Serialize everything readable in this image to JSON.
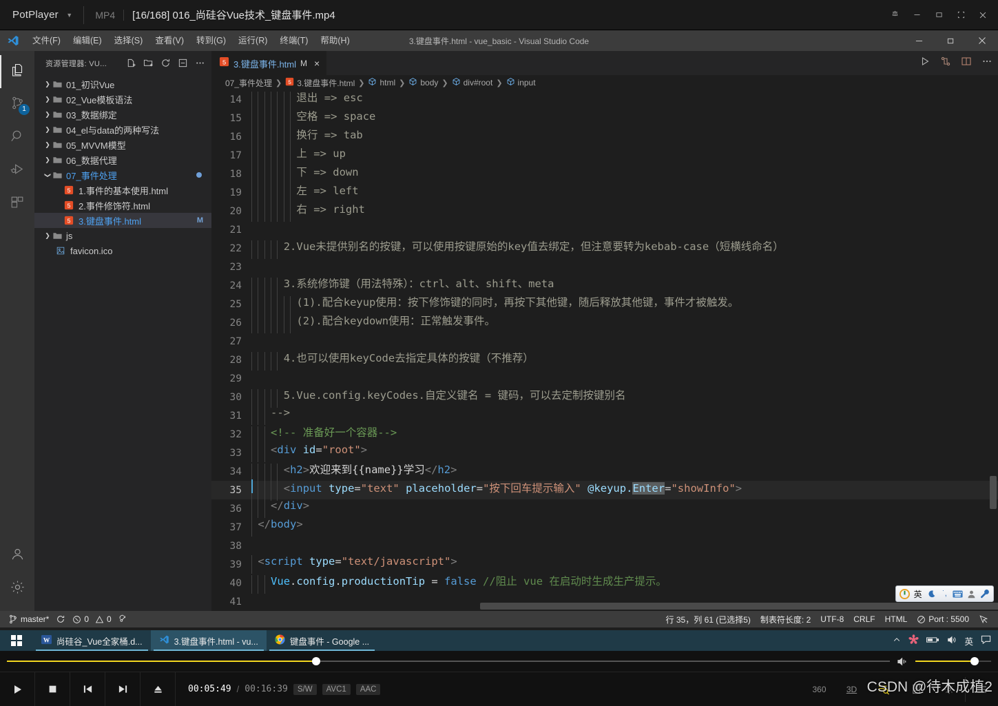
{
  "potplayer": {
    "app_name": "PotPlayer",
    "format": "MP4",
    "file_title": "[16/168] 016_尚硅谷Vue技术_键盘事件.mp4",
    "window_buttons": [
      "pin-icon",
      "minimize-icon",
      "maximize-icon",
      "fullscreen-icon",
      "close-icon"
    ],
    "controls": {
      "time_current": "00:05:49",
      "time_separator": "/",
      "time_total": "00:16:39",
      "chips": [
        "S/W",
        "AVC1",
        "AAC"
      ],
      "seek_percent": 35,
      "volume_percent": 78,
      "right_buttons": [
        "360",
        "3D",
        "playlist-search-icon",
        "playlist-icon",
        "settings-icon"
      ],
      "transport": [
        "play-icon",
        "stop-icon",
        "previous-icon",
        "next-icon",
        "eject-icon"
      ]
    },
    "watermark": "CSDN @待木成植2"
  },
  "vscode": {
    "title": "3.键盘事件.html - vue_basic - Visual Studio Code",
    "menu": [
      "文件(F)",
      "编辑(E)",
      "选择(S)",
      "查看(V)",
      "转到(G)",
      "运行(R)",
      "终端(T)",
      "帮助(H)"
    ],
    "window_buttons": [
      "minimize-icon",
      "restore-icon",
      "close-icon"
    ],
    "activitybar": [
      {
        "name": "explorer",
        "icon": "files-icon",
        "active": true,
        "badge": null
      },
      {
        "name": "source-control",
        "icon": "source-control-icon",
        "active": false,
        "badge": "1"
      },
      {
        "name": "search",
        "icon": "search-icon",
        "active": false,
        "badge": null
      },
      {
        "name": "run-and-debug",
        "icon": "run-debug-icon",
        "active": false,
        "badge": null
      },
      {
        "name": "extensions",
        "icon": "extensions-icon",
        "active": false,
        "badge": null
      },
      {
        "name": "accounts",
        "icon": "account-icon",
        "active": false,
        "badge": null
      },
      {
        "name": "settings",
        "icon": "gear-icon",
        "active": false,
        "badge": null
      }
    ],
    "explorer": {
      "header": "资源管理器: VU...",
      "actions": [
        "new-file-icon",
        "new-folder-icon",
        "refresh-icon",
        "collapse-all-icon",
        "more-actions-icon"
      ],
      "tree": [
        {
          "label": "01_初识Vue",
          "type": "folder",
          "expanded": false,
          "depth": 0
        },
        {
          "label": "02_Vue模板语法",
          "type": "folder",
          "expanded": false,
          "depth": 0
        },
        {
          "label": "03_数据绑定",
          "type": "folder",
          "expanded": false,
          "depth": 0
        },
        {
          "label": "04_el与data的两种写法",
          "type": "folder",
          "expanded": false,
          "depth": 0
        },
        {
          "label": "05_MVVM模型",
          "type": "folder",
          "expanded": false,
          "depth": 0
        },
        {
          "label": "06_数据代理",
          "type": "folder",
          "expanded": false,
          "depth": 0
        },
        {
          "label": "07_事件处理",
          "type": "folder",
          "expanded": true,
          "depth": 0,
          "highlight": true,
          "dot": true
        },
        {
          "label": "1.事件的基本使用.html",
          "type": "html",
          "depth": 1
        },
        {
          "label": "2.事件修饰符.html",
          "type": "html",
          "depth": 1
        },
        {
          "label": "3.键盘事件.html",
          "type": "html",
          "depth": 1,
          "selected": true,
          "highlight": true,
          "badge": "M"
        },
        {
          "label": "js",
          "type": "folder",
          "expanded": false,
          "depth": 0
        },
        {
          "label": "favicon.ico",
          "type": "image",
          "depth": 1
        }
      ]
    },
    "tab": {
      "label": "3.键盘事件.html",
      "dirty_flag": "M",
      "close": "×",
      "icon": "html5-icon"
    },
    "editor_actions": [
      "run-icon",
      "split-compare-icon",
      "split-editor-icon",
      "more-actions-icon"
    ],
    "breadcrumb": [
      "07_事件处理",
      "3.键盘事件.html",
      "html",
      "body",
      "div#root",
      "input"
    ],
    "statusbar": {
      "branch": "master*",
      "sync_icon": "sync-icon",
      "errors": "0",
      "warnings": "0",
      "ports_icon": "radio-tower-icon",
      "position": "行 35，列 61 (已选择5)",
      "tabsize": "制表符长度: 2",
      "encoding": "UTF-8",
      "eol": "CRLF",
      "language": "HTML",
      "liveserver": "Port : 5500",
      "feedback_icon": "feedback-icon"
    },
    "code": {
      "first_line_number": 14,
      "current_line": 35,
      "lines": [
        {
          "n": 14,
          "indent": 7,
          "tokens": [
            {
              "t": "退出 => esc",
              "c": "t-cblock"
            }
          ]
        },
        {
          "n": 15,
          "indent": 7,
          "tokens": [
            {
              "t": "空格 => space",
              "c": "t-cblock"
            }
          ]
        },
        {
          "n": 16,
          "indent": 7,
          "tokens": [
            {
              "t": "换行 => tab",
              "c": "t-cblock"
            }
          ]
        },
        {
          "n": 17,
          "indent": 7,
          "tokens": [
            {
              "t": "上 => up",
              "c": "t-cblock"
            }
          ]
        },
        {
          "n": 18,
          "indent": 7,
          "tokens": [
            {
              "t": "下 => down",
              "c": "t-cblock"
            }
          ]
        },
        {
          "n": 19,
          "indent": 7,
          "tokens": [
            {
              "t": "左 => left",
              "c": "t-cblock"
            }
          ]
        },
        {
          "n": 20,
          "indent": 7,
          "tokens": [
            {
              "t": "右 => right",
              "c": "t-cblock"
            }
          ]
        },
        {
          "n": 21,
          "indent": 0,
          "tokens": []
        },
        {
          "n": 22,
          "indent": 5,
          "tokens": [
            {
              "t": "2.Vue未提供别名的按键，可以使用按键原始的key值去绑定，但注意要转为kebab-case（短横线命名）",
              "c": "t-cblock"
            }
          ]
        },
        {
          "n": 23,
          "indent": 0,
          "tokens": []
        },
        {
          "n": 24,
          "indent": 5,
          "tokens": [
            {
              "t": "3.系统修饰键（用法特殊）：ctrl、alt、shift、meta",
              "c": "t-cblock"
            }
          ]
        },
        {
          "n": 25,
          "indent": 7,
          "tokens": [
            {
              "t": "(1).配合keyup使用：按下修饰键的同时，再按下其他键，随后释放其他键，事件才被触发。",
              "c": "t-cblock"
            }
          ]
        },
        {
          "n": 26,
          "indent": 7,
          "tokens": [
            {
              "t": "(2).配合keydown使用：正常触发事件。",
              "c": "t-cblock"
            }
          ]
        },
        {
          "n": 27,
          "indent": 0,
          "tokens": []
        },
        {
          "n": 28,
          "indent": 5,
          "tokens": [
            {
              "t": "4.也可以使用keyCode去指定具体的按键（不推荐）",
              "c": "t-cblock"
            }
          ]
        },
        {
          "n": 29,
          "indent": 0,
          "tokens": []
        },
        {
          "n": 30,
          "indent": 5,
          "tokens": [
            {
              "t": "5.Vue.config.keyCodes.自定义键名 = 键码，可以去定制按键别名",
              "c": "t-cblock"
            }
          ]
        },
        {
          "n": 31,
          "indent": 3,
          "tokens": [
            {
              "t": "-->",
              "c": "t-cblock"
            }
          ]
        },
        {
          "n": 32,
          "indent": 3,
          "tokens": [
            {
              "t": "<!-- 准备好一个容器-->",
              "c": "t-com"
            }
          ]
        },
        {
          "n": 33,
          "indent": 3,
          "tokens": [
            {
              "t": "<",
              "c": "t-punc"
            },
            {
              "t": "div",
              "c": "t-tag"
            },
            {
              "t": " ",
              "c": "t-plain"
            },
            {
              "t": "id",
              "c": "t-attr"
            },
            {
              "t": "=",
              "c": "t-eq"
            },
            {
              "t": "\"root\"",
              "c": "t-str"
            },
            {
              "t": ">",
              "c": "t-punc"
            }
          ]
        },
        {
          "n": 34,
          "indent": 5,
          "tokens": [
            {
              "t": "<",
              "c": "t-punc"
            },
            {
              "t": "h2",
              "c": "t-tag"
            },
            {
              "t": ">",
              "c": "t-punc"
            },
            {
              "t": "欢迎来到{{name}}学习",
              "c": "t-txt"
            },
            {
              "t": "</",
              "c": "t-punc"
            },
            {
              "t": "h2",
              "c": "t-tag"
            },
            {
              "t": ">",
              "c": "t-punc"
            }
          ]
        },
        {
          "n": 35,
          "indent": 5,
          "current": true,
          "tokens": [
            {
              "t": "<",
              "c": "t-punc"
            },
            {
              "t": "input",
              "c": "t-tag"
            },
            {
              "t": " ",
              "c": "t-plain"
            },
            {
              "t": "type",
              "c": "t-attr"
            },
            {
              "t": "=",
              "c": "t-eq"
            },
            {
              "t": "\"text\"",
              "c": "t-str"
            },
            {
              "t": " ",
              "c": "t-plain"
            },
            {
              "t": "placeholder",
              "c": "t-attr"
            },
            {
              "t": "=",
              "c": "t-eq"
            },
            {
              "t": "\"按下回车提示输入\"",
              "c": "t-str"
            },
            {
              "t": " ",
              "c": "t-plain"
            },
            {
              "t": "@keyup.",
              "c": "t-attr"
            },
            {
              "t": "Enter",
              "c": "t-attr sel"
            },
            {
              "t": "=",
              "c": "t-eq"
            },
            {
              "t": "\"showInfo\"",
              "c": "t-str"
            },
            {
              "t": ">",
              "c": "t-punc"
            }
          ]
        },
        {
          "n": 36,
          "indent": 3,
          "tokens": [
            {
              "t": "</",
              "c": "t-punc"
            },
            {
              "t": "div",
              "c": "t-tag"
            },
            {
              "t": ">",
              "c": "t-punc"
            }
          ]
        },
        {
          "n": 37,
          "indent": 1,
          "tokens": [
            {
              "t": "</",
              "c": "t-punc"
            },
            {
              "t": "body",
              "c": "t-tag"
            },
            {
              "t": ">",
              "c": "t-punc"
            }
          ]
        },
        {
          "n": 38,
          "indent": 0,
          "tokens": []
        },
        {
          "n": 39,
          "indent": 1,
          "tokens": [
            {
              "t": "<",
              "c": "t-punc"
            },
            {
              "t": "script",
              "c": "t-tag"
            },
            {
              "t": " ",
              "c": "t-plain"
            },
            {
              "t": "type",
              "c": "t-attr"
            },
            {
              "t": "=",
              "c": "t-eq"
            },
            {
              "t": "\"text/javascript\"",
              "c": "t-str"
            },
            {
              "t": ">",
              "c": "t-punc"
            }
          ]
        },
        {
          "n": 40,
          "indent": 3,
          "tokens": [
            {
              "t": "Vue",
              "c": "t-var"
            },
            {
              "t": ".",
              "c": "t-plain"
            },
            {
              "t": "config",
              "c": "t-prop"
            },
            {
              "t": ".",
              "c": "t-plain"
            },
            {
              "t": "productionTip",
              "c": "t-prop"
            },
            {
              "t": " = ",
              "c": "t-plain"
            },
            {
              "t": "false",
              "c": "t-num"
            },
            {
              "t": " //阻止 vue 在启动时生成生产提示。",
              "c": "t-cmt2"
            }
          ]
        },
        {
          "n": 41,
          "indent": 0,
          "tokens": []
        }
      ]
    }
  },
  "ime": {
    "items": [
      "sogou-logo-icon",
      "英",
      "moon-icon",
      "punctuation-icon",
      "keyboard-icon",
      "user-icon",
      "tools-icon"
    ]
  },
  "taskbar": {
    "start": "windows-start-icon",
    "items": [
      {
        "label": "尚硅谷_Vue全家桶.d...",
        "icon": "word-icon",
        "active": false
      },
      {
        "label": "3.键盘事件.html - vu...",
        "icon": "vscode-icon",
        "active": true
      },
      {
        "label": "键盘事件 - Google ...",
        "icon": "chrome-icon",
        "active": false
      }
    ],
    "tray": [
      "chevron-up-icon",
      "sogou-icon",
      "battery-icon",
      "volume-icon",
      "英",
      "action-center-icon"
    ]
  },
  "colors": {
    "accent_yellow": "#f2d620",
    "vscode_blue": "#4ea1f0",
    "taskbar": "#1f3a47",
    "statusbar": "#3c3c3c"
  }
}
